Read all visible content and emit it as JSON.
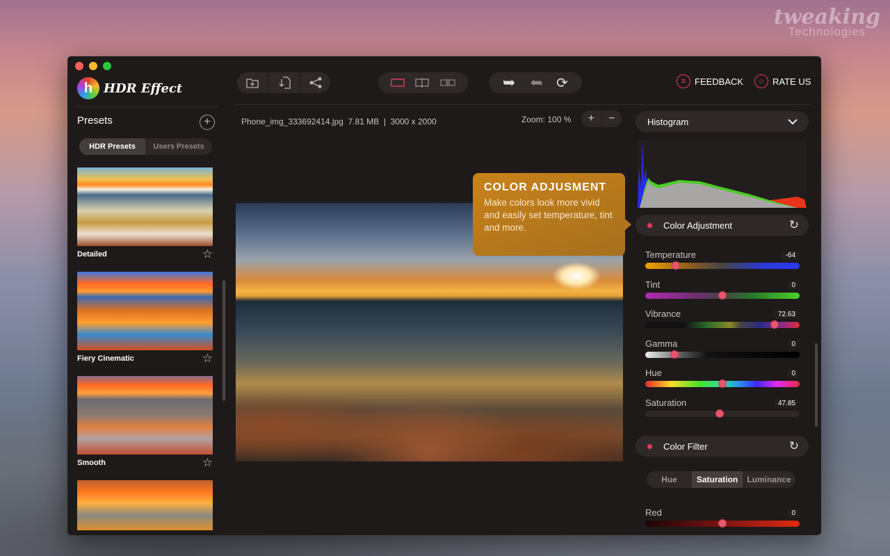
{
  "watermark": {
    "line1": "tweaking",
    "line2": "Technologies"
  },
  "app": {
    "title": "HDR Effect",
    "logo_letter": "h"
  },
  "toolbar": {
    "file_group": [
      {
        "icon": "folder-add-icon",
        "glyph": "🗀"
      },
      {
        "icon": "export-file-icon",
        "glyph": "⤓"
      },
      {
        "icon": "share-icon",
        "glyph": "⋖"
      }
    ],
    "view_group": [
      {
        "icon": "single-view-icon",
        "active": true
      },
      {
        "icon": "split-view-icon",
        "active": false
      },
      {
        "icon": "side-by-side-view-icon",
        "active": false
      }
    ],
    "history_group": [
      {
        "icon": "undo-icon",
        "glyph": "↩"
      },
      {
        "icon": "redo-icon",
        "glyph": "↪"
      },
      {
        "icon": "reset-icon",
        "glyph": "⟳"
      }
    ],
    "feedback_label": "FEEDBACK",
    "rate_label": "RATE US"
  },
  "sidebar": {
    "title": "Presets",
    "tabs": [
      {
        "label": "HDR Presets",
        "active": true
      },
      {
        "label": "Users Presets",
        "active": false
      }
    ],
    "presets": [
      {
        "name": "Detailed"
      },
      {
        "name": "Fiery Cinematic"
      },
      {
        "name": "Smooth"
      },
      {
        "name": ""
      }
    ]
  },
  "file": {
    "name": "Phone_img_333692414.jpg",
    "size": "7.81 MB",
    "separator": "|",
    "dimensions": "3000 x 2000"
  },
  "zoom": {
    "label": "Zoom: 100 %",
    "plus": "+",
    "minus": "−"
  },
  "tooltip": {
    "title": "COLOR ADJUSMENT",
    "body": "Make colors look more vivid and easily set temperature, tint and more."
  },
  "panel": {
    "dropdown": "Histogram",
    "color_adjustment": {
      "title": "Color Adjustment",
      "sliders": [
        {
          "name": "Temperature",
          "value": "-64",
          "position": 0.2
        },
        {
          "name": "Tint",
          "value": "0",
          "position": 0.5
        },
        {
          "name": "Vibrance",
          "value": "72.63",
          "position": 0.84
        },
        {
          "name": "Gamma",
          "value": "0",
          "position": 0.19
        },
        {
          "name": "Hue",
          "value": "0",
          "position": 0.5
        },
        {
          "name": "Saturation",
          "value": "47.85",
          "position": 0.48
        }
      ]
    },
    "color_filter": {
      "title": "Color Filter",
      "tabs": [
        {
          "label": "Hue",
          "active": false
        },
        {
          "label": "Saturation",
          "active": true
        },
        {
          "label": "Luminance",
          "active": false
        }
      ],
      "sliders": [
        {
          "name": "Red",
          "value": "0",
          "position": 0.5
        }
      ]
    }
  },
  "colors": {
    "accent": "#e23c5b",
    "tooltip": "#c9821a",
    "window_bg": "#1e1a19"
  }
}
